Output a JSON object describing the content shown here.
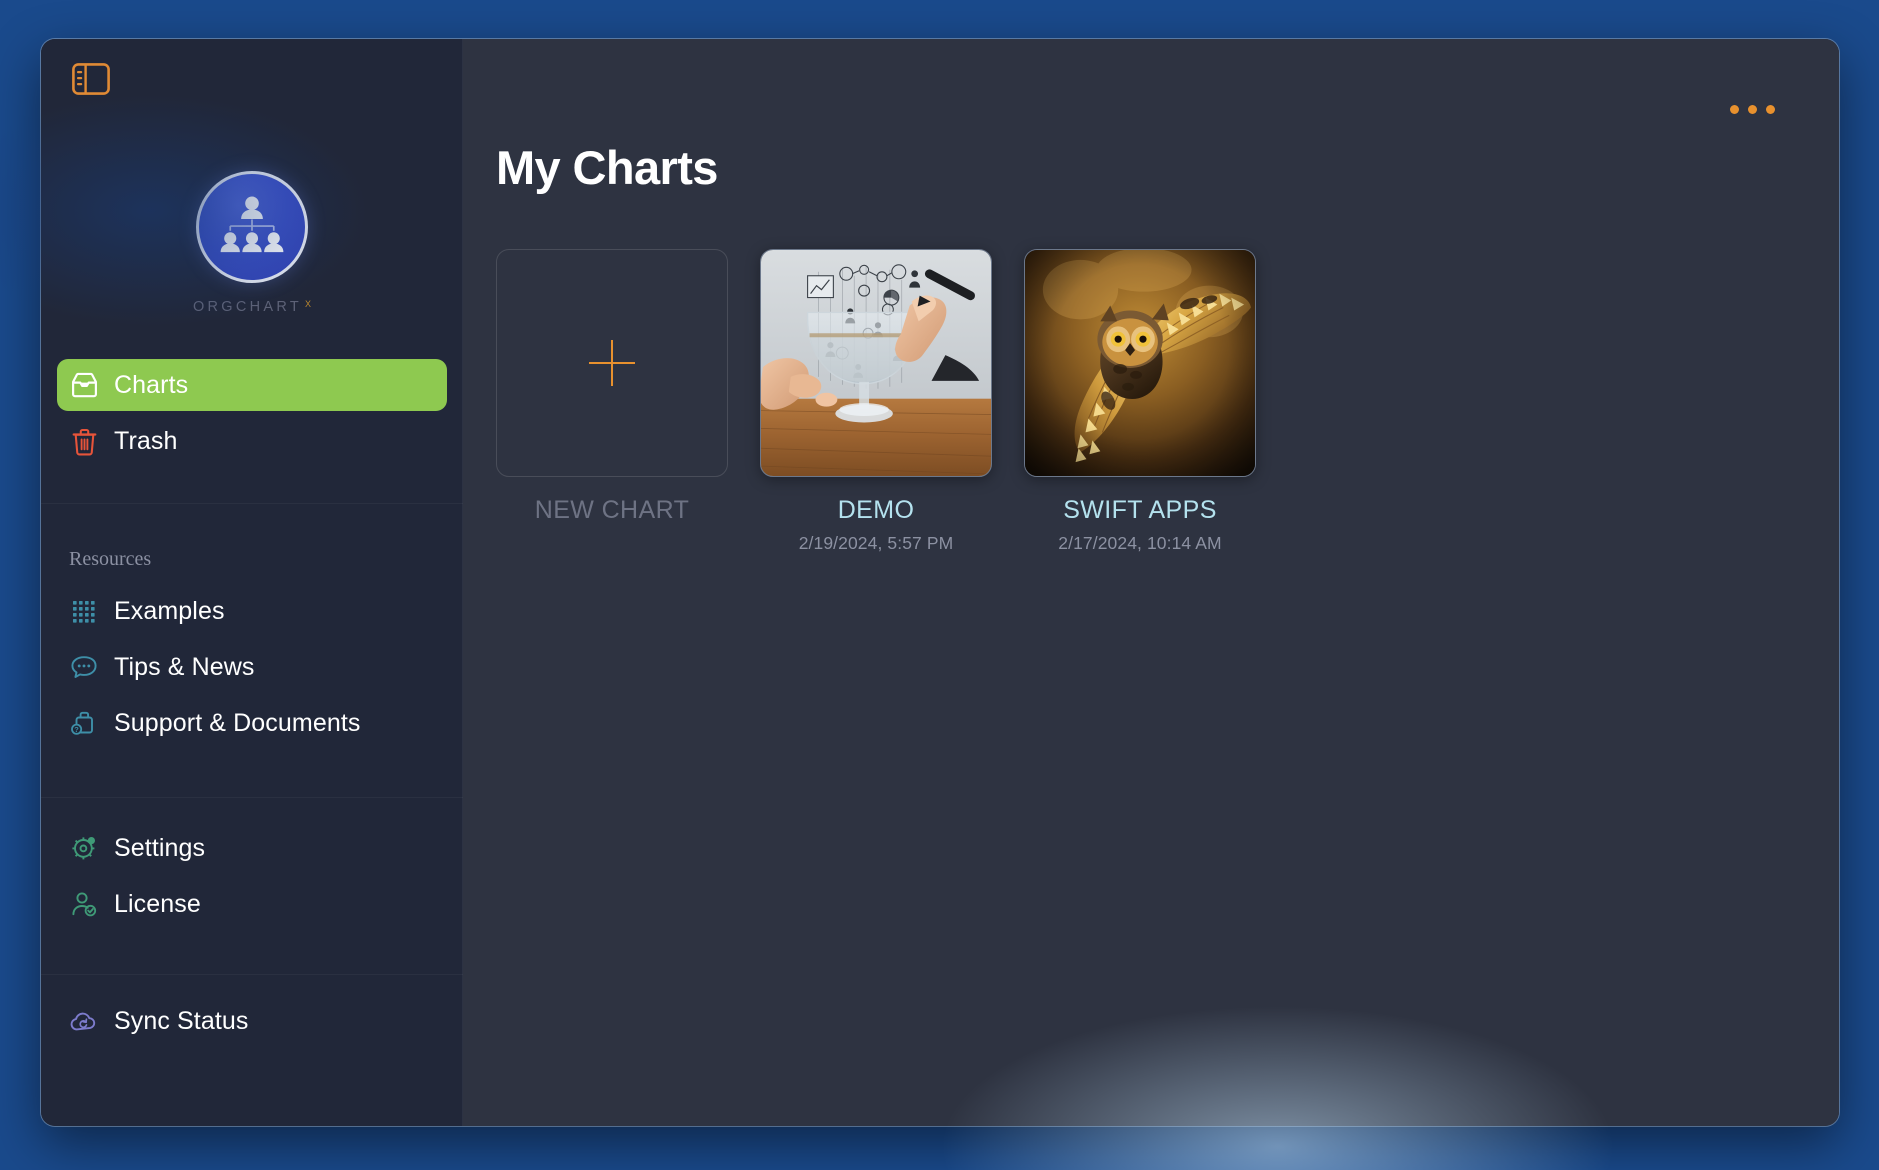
{
  "window": {
    "app_name": "OrgChart X",
    "sidebar_toggle_icon": "sidebar-toggle-icon",
    "overflow_menu_icon": "kebab-menu-icon"
  },
  "sidebar": {
    "logo": {
      "icon": "org-chart-logo-icon",
      "wordmark": "ORGCHART",
      "superscript": "X"
    },
    "primary_items": [
      {
        "label": "Charts",
        "icon": "inbox-tray-icon",
        "active": true,
        "icon_color": "#ffffff"
      },
      {
        "label": "Trash",
        "icon": "trash-can-icon",
        "active": false,
        "icon_color": "#e7543a"
      }
    ],
    "resources_label": "Resources",
    "resource_items": [
      {
        "label": "Examples",
        "icon": "grid-dots-icon",
        "icon_color": "#3e8fa8"
      },
      {
        "label": "Tips & News",
        "icon": "speech-bubble-icon",
        "icon_color": "#3e8fa8"
      },
      {
        "label": "Support & Documents",
        "icon": "help-briefcase-icon",
        "icon_color": "#3e8fa8"
      }
    ],
    "settings_items": [
      {
        "label": "Settings",
        "icon": "gear-icon",
        "icon_color": "#3f9a77"
      },
      {
        "label": "License",
        "icon": "person-check-icon",
        "icon_color": "#3f9a77"
      }
    ],
    "footer_items": [
      {
        "label": "Sync Status",
        "icon": "cloud-sync-icon",
        "icon_color": "#7d7ccd"
      }
    ]
  },
  "main": {
    "title": "My Charts",
    "tiles": [
      {
        "kind": "new",
        "caption": "NEW CHART",
        "date": "",
        "icon": "plus-icon"
      },
      {
        "kind": "chart",
        "caption": "DEMO",
        "date": "2/19/2024, 5:57 PM",
        "thumbnail": "hands-drawing-orgchart-over-glass"
      },
      {
        "kind": "chart",
        "caption": "SWIFT APPS",
        "date": "2/17/2024, 10:14 AM",
        "thumbnail": "owl-in-flight"
      }
    ]
  },
  "colors": {
    "accent_orange": "#e8912e",
    "active_green": "#8ec950",
    "chart_name_cyan": "#b4e2ee",
    "sidebar_bg": "#212739",
    "main_bg": "#2e3341",
    "trash_red": "#e7543a",
    "teal_icon": "#3e8fa8",
    "green_icon": "#3f9a77",
    "purple_icon": "#7d7ccd"
  }
}
